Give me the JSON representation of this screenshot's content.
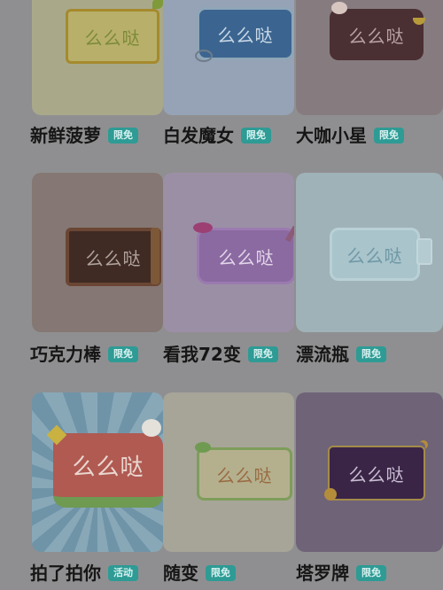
{
  "colors": {
    "background": "#8f8f91",
    "tag_bg": "#2e9b95",
    "title_text": "#161616"
  },
  "bubble_text": "么么哒",
  "items": [
    {
      "title": "新鲜菠萝",
      "tag": "限免"
    },
    {
      "title": "白发魔女",
      "tag": "限免"
    },
    {
      "title": "大咖小星",
      "tag": "限免"
    },
    {
      "title": "巧克力棒",
      "tag": "限免"
    },
    {
      "title": "看我72变",
      "tag": "限免"
    },
    {
      "title": "漂流瓶",
      "tag": "限免"
    },
    {
      "title": "拍了拍你",
      "tag": "活动"
    },
    {
      "title": "随变",
      "tag": "限免"
    },
    {
      "title": "塔罗牌",
      "tag": "限免"
    }
  ]
}
